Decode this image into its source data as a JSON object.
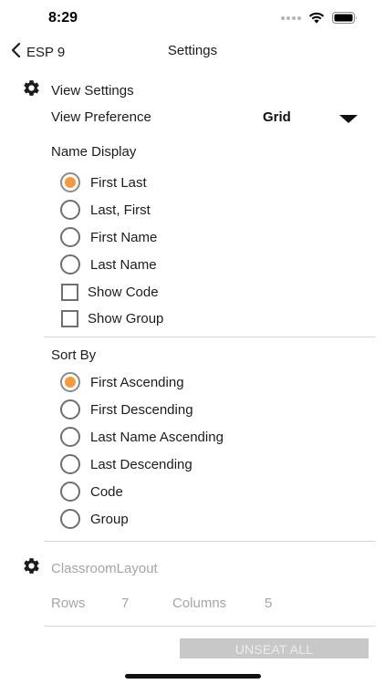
{
  "status_bar": {
    "time": "8:29",
    "icons": [
      "signal-dots-icon",
      "wifi-icon",
      "battery-icon"
    ]
  },
  "nav": {
    "back_label": "ESP 9",
    "title": "Settings",
    "back_icon": "chevron-left-icon"
  },
  "view_settings": {
    "icon": "gear-icon",
    "title": "View Settings",
    "view_preference": {
      "label": "View Preference",
      "value": "Grid",
      "caret_icon": "caret-down-icon"
    },
    "name_display": {
      "label": "Name Display",
      "options": [
        {
          "label": "First Last",
          "type": "radio",
          "selected": true
        },
        {
          "label": "Last, First",
          "type": "radio",
          "selected": false
        },
        {
          "label": "First Name",
          "type": "radio",
          "selected": false
        },
        {
          "label": "Last Name",
          "type": "radio",
          "selected": false
        },
        {
          "label": "Show Code",
          "type": "checkbox",
          "checked": false
        },
        {
          "label": "Show Group",
          "type": "checkbox",
          "checked": false
        }
      ]
    },
    "sort_by": {
      "label": "Sort By",
      "options": [
        {
          "label": "First Ascending",
          "selected": true
        },
        {
          "label": "First Descending",
          "selected": false
        },
        {
          "label": "Last Name Ascending",
          "selected": false
        },
        {
          "label": "Last Descending",
          "selected": false
        },
        {
          "label": "Code",
          "selected": false
        },
        {
          "label": "Group",
          "selected": false
        }
      ]
    }
  },
  "classroom_layout": {
    "icon": "gear-icon",
    "title": "ClassroomLayout",
    "rows_label": "Rows",
    "rows_value": "7",
    "columns_label": "Columns",
    "columns_value": "5",
    "unseat_label": "UNSEAT ALL"
  },
  "colors": {
    "accent": "#f19a3e",
    "disabled_text": "#a5a5a5",
    "button_bg": "#c8c8c8"
  }
}
